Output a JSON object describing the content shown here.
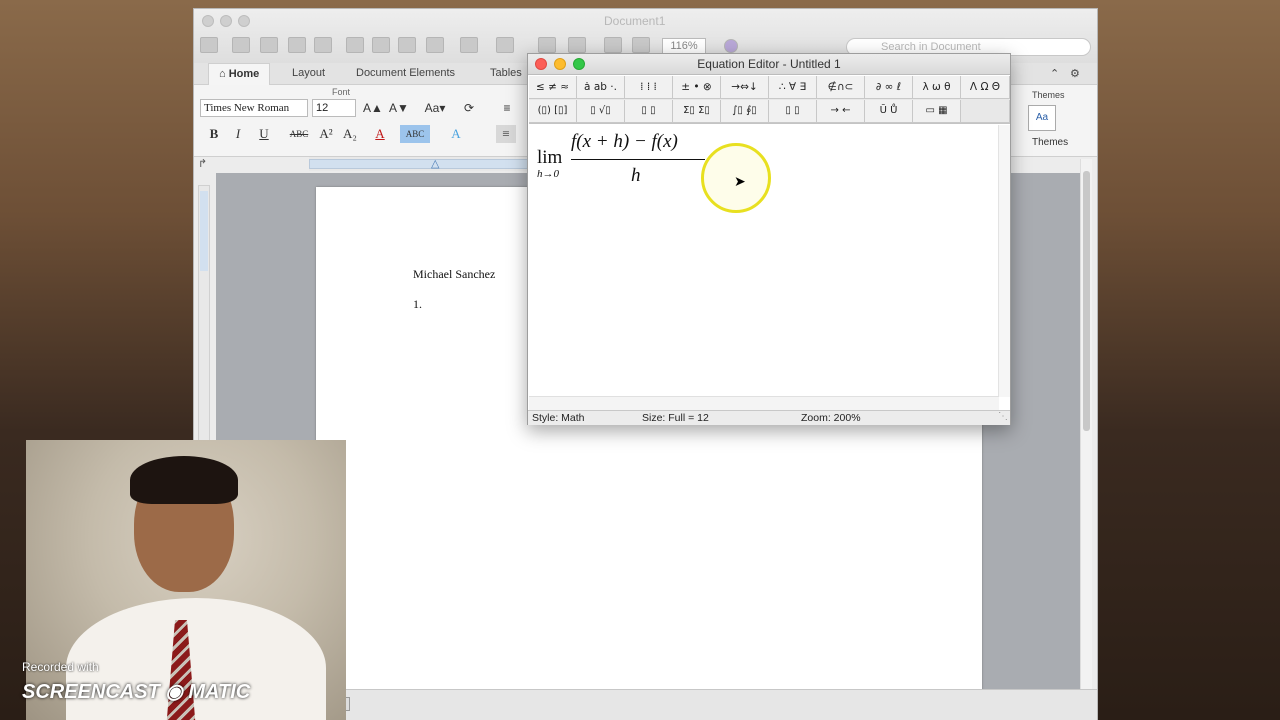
{
  "word": {
    "title": "Document1",
    "zoom": "116%",
    "search_placeholder": "Search in Document",
    "tabs": [
      "Home",
      "Layout",
      "Document Elements",
      "Tables"
    ],
    "font_group_label": "Font",
    "font_name": "Times New Roman",
    "font_size": "12",
    "themes_top_label": "Themes",
    "themes_label": "Themes",
    "document": {
      "author": "Michael Sanchez",
      "item": "1."
    }
  },
  "equation_editor": {
    "title": "Equation Editor - Untitled 1",
    "palette_row1": [
      "≤ ≠ ≈",
      "ȧ ab ·.",
      "⁞ ⁞ ⁞",
      "± • ⊗",
      "→⇔↓",
      "∴ ∀ ∃",
      "∉∩⊂",
      "∂ ∞ ℓ",
      "λ ω θ",
      "Λ Ω Θ"
    ],
    "palette_row2": [
      "(▯) [▯]",
      "▯ √▯",
      "▯ ▯",
      "Σ▯ Σ▯",
      "∫▯ ∮▯",
      "▯ ▯",
      "→ ←",
      "Ū Ů",
      "▭ ▦"
    ],
    "equation": {
      "lim": "lim",
      "lim_sub": "h→0",
      "numerator": "f(x + h) − f(x)",
      "denominator": "h"
    },
    "status": {
      "style": "Style: Math",
      "size": "Size: Full = 12",
      "zoom": "Zoom: 200%"
    }
  },
  "watermark": {
    "small": "Recorded with",
    "big": "SCREENCAST ◉ MATIC"
  }
}
